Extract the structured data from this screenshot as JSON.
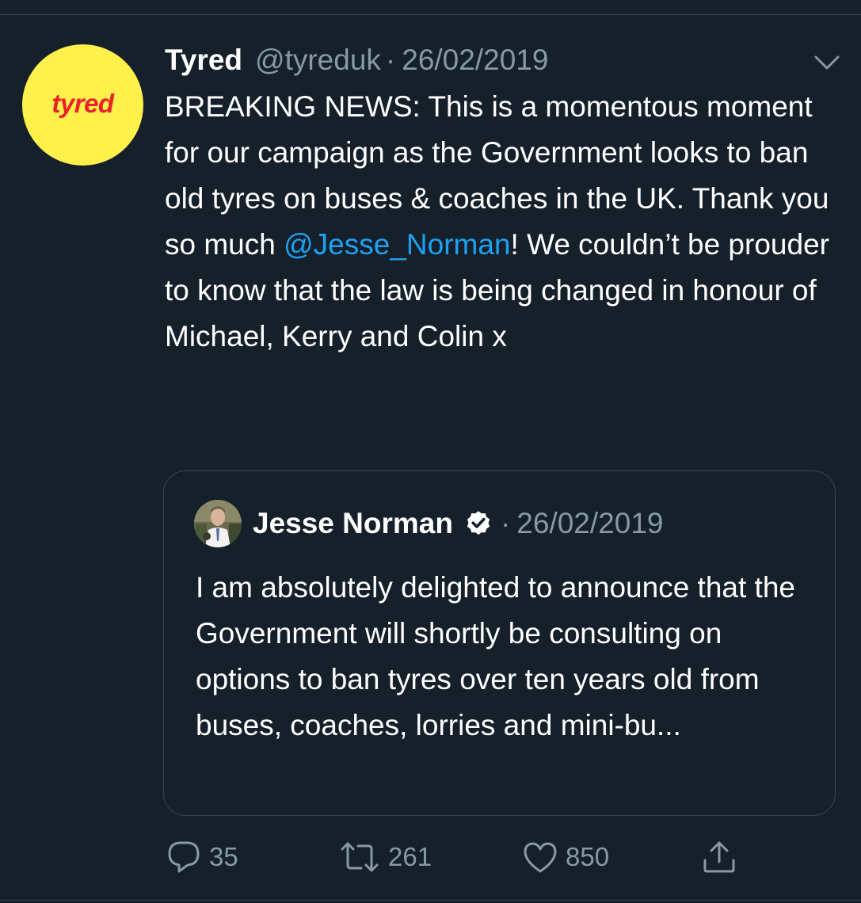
{
  "tweet": {
    "avatar_logo_text": "tyred",
    "display_name": "Tyred",
    "handle": "@tyreduk",
    "separator": "·",
    "date": "26/02/2019",
    "text_before_mention": "BREAKING NEWS: This is a momentous moment for our campaign as the Government looks to ban old tyres on buses & coaches in the UK. Thank you so much ",
    "mention": "@Jesse_Norman",
    "text_after_mention": "! We couldn’t be prouder to know that the law is being changed in honour of Michael, Kerry and Colin x",
    "menu_icon": "chevron-down-icon"
  },
  "quoted_tweet": {
    "display_name": "Jesse Norman",
    "verified_icon": "verified-badge-icon",
    "separator": "·",
    "date": "26/02/2019",
    "text": "I am absolutely delighted to announce that the Government will shortly be consulting on options to ban tyres over ten years old from buses, coaches, lorries and mini-bu..."
  },
  "actions": {
    "reply": {
      "icon": "reply-icon",
      "count": "35"
    },
    "retweet": {
      "icon": "retweet-icon",
      "count": "261"
    },
    "like": {
      "icon": "heart-icon",
      "count": "850"
    },
    "share": {
      "icon": "share-icon"
    }
  },
  "colors": {
    "background": "#15202b",
    "divider": "#38444d",
    "secondary_text": "#8899a6",
    "mention": "#1da1f2",
    "avatar_bg": "#fff04c",
    "avatar_logo": "#e8222b"
  }
}
